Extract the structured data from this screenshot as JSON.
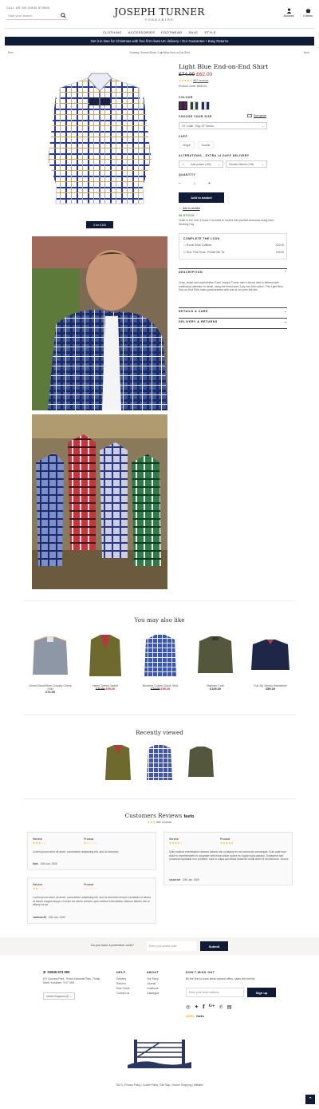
{
  "header": {
    "call_text": "CALL US ON 01845 573500",
    "search_placeholder": "Start your search",
    "brand": "JOSEPH TURNER",
    "brand_sub": "YORKSHIRE",
    "account_label": "Account",
    "basket_label": "0 Items"
  },
  "nav": [
    "CLOTHING",
    "ACCESSORIES",
    "FOOTWEAR",
    "SALE",
    "STYLE"
  ],
  "promo": "Get it in time for Christmas with free first class UK delivery  •  Our Guarantee  •  Easy Returns",
  "breadcrumb": {
    "back": "Prev",
    "path": "Clothing / Formal Shirts / Light Blue End-on-End Shirt",
    "next": "Next"
  },
  "gallery": {
    "badge": "3 for £100"
  },
  "product": {
    "title": "Light Blue End-on-End Shirt",
    "old_price": "£74.00",
    "new_price": "£62.00",
    "stars": "★★★★★",
    "reviews_link": "882 reviews",
    "code": "Product Code: MBE10L",
    "colour_label": "COLOUR",
    "size_label": "CHOOSE YOUR SIZE",
    "size_guide": "Size guide",
    "size_value": "15\" Collar - Reg 33\" Sleeve",
    "cuff_label": "CUFF",
    "cuff_options": [
      "Single",
      "Double"
    ],
    "alterations_label": "ALTERATIONS - EXTRA 14 DAYS DELIVERY",
    "alt_option1": "Add pocket (+£5)",
    "alt_option2": "Shorten Sleeve (+£8)",
    "quantity_label": "QUANTITY",
    "quantity_value": "1",
    "add_button": "Add to basket",
    "wishlist": "Add to wishlist",
    "stock": "IN STOCK",
    "stock_note": "Order in the next 3 hours 2 minutes to receive this product tomorrow using Next Working Day",
    "complete_title": "COMPLETE THE LOOK",
    "complete_items": [
      {
        "name": "Round Silver Cufflinks",
        "price": "£20.00"
      },
      {
        "name": "Red / Pink Floral - Printed Silk Tie",
        "price": "£39.00"
      }
    ],
    "description_label": "DESCRIPTION",
    "description_text": "Crisp, smart and comfortable. Each Joseph Turner men's formal shirt is tailored with meticulous attention to detail, using the finest pure 2-ply two-fold cotton. This Light Blue End-on-End Shirt looks great teamed with one of our pure silk ties.",
    "details_label": "DETAILS & CARE",
    "delivery_label": "DELIVERY & RETURNS"
  },
  "also_like": {
    "title": "You may also like",
    "items": [
      {
        "name": "Green/Sand/Wine Country Check Shirt",
        "price": "£74.00",
        "sale": ""
      },
      {
        "name": "Haley Tweed Jacket",
        "price": "£74.00",
        "sale": "£59.20"
      },
      {
        "name": "Brushed Cotton Check Shirt",
        "price": "£74.00",
        "sale": "£59.20"
      },
      {
        "name": "Malham Coat",
        "price": "£129.20",
        "sale": ""
      },
      {
        "name": "Full-Zip Jersey Sweatshirt",
        "price": "£59.20",
        "sale": ""
      }
    ]
  },
  "recent": {
    "title": "Recently viewed"
  },
  "reviews": {
    "title": "Customers Reviews",
    "feefo": "feefo",
    "count": "882 reviews",
    "stars": "★★★",
    "cards": [
      {
        "service": "Service",
        "product": "Product",
        "s_stars": "★★★☆☆",
        "p_stars": "★☆☆☆☆",
        "text": "Lorem ipsum dolor sit amet, consectetur adipiscing elit, sed do eiusmod",
        "author": "Kate",
        "date": "10th Jan, 2000"
      },
      {
        "service": "Service",
        "product": "Product",
        "s_stars": "★★★★☆",
        "p_stars": "★★★★★",
        "text": "Quis nostrud exercitation ullamco laboris nisi ut aliquip ex ea commodo consequat. Duis aute irure dolor in reprehenderit in voluptate velit esse cillum dolore eu fugiat nulla pariatur. Excepteur sint occaecat cupidatat non proident, sunt in culpa qui officia deserunt mollit anim id est laborum. Donec",
        "author": "stockrest",
        "date": "10th Jan, 2000"
      },
      {
        "service": "Service",
        "product": "Product",
        "s_stars": "★★☆☆☆",
        "p_stars": "☆☆☆☆☆",
        "text": "Lorem ipsum dolor sit amet, consectetur adipiscing elit, sed do eiusmod tempor incididunt ut labore et dolore magna aliqua. Ut enim ad minim veniam, quis nostrud exercitation ullamco laboris nisi ut aliquip ex ea",
        "author": "cadmoor48",
        "date": "10th Jan, 2000"
      }
    ]
  },
  "promocode": {
    "question": "Do you have a promotion code?",
    "placeholder": "Enter your promo code",
    "submit": "Submit"
  },
  "footer": {
    "phone": "01845 573 500",
    "address": "8-9 Concept Park, Thirsk Industrial Park, Thirsk, North Yorkshire, YO7 3SH",
    "country": "United Kingdom (£)",
    "help_title": "HELP",
    "help_links": [
      "Delivery",
      "Returns",
      "Size Guide",
      "Contact us"
    ],
    "about_title": "ABOUT",
    "about_links": [
      "Our Story",
      "Journal",
      "Lookbook",
      "Catalogue"
    ],
    "news_title": "DON'T MISS OUT",
    "news_text": "Be the first to know about special offers, sales and events.",
    "email_placeholder": "Enter your email address",
    "signup": "Sign up",
    "feefo_score": "100%",
    "feefo": "feefo",
    "legal": "T&C's | Privacy Policy | Cookie Policy | Site Map | Secure Shopping | Affiliates"
  }
}
